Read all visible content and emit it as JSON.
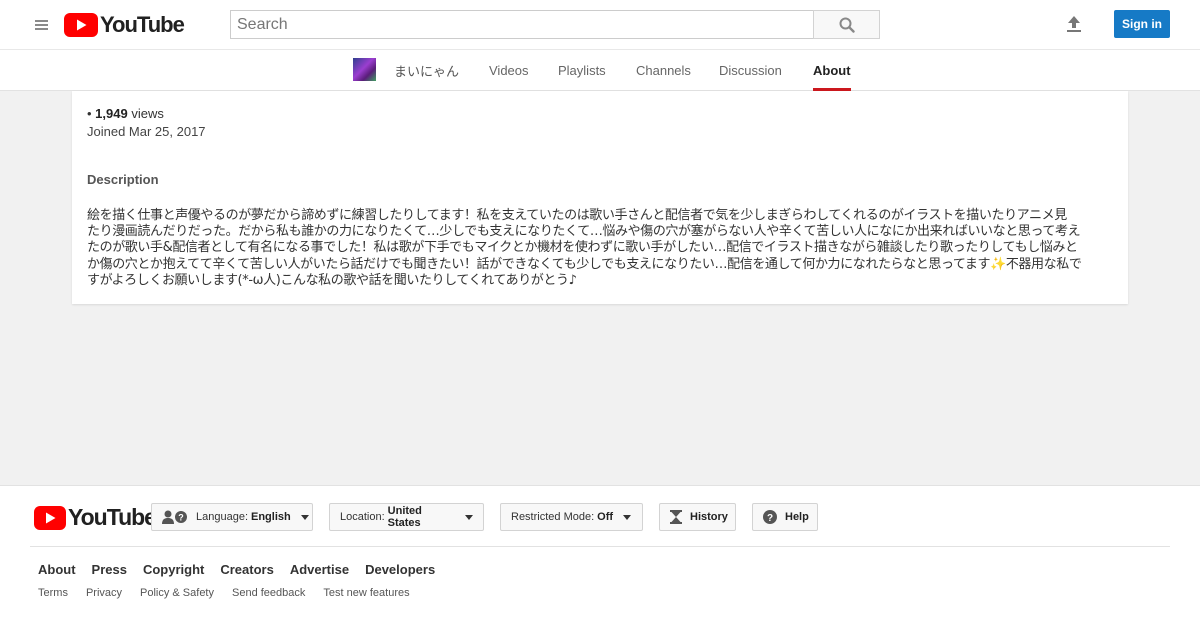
{
  "masthead": {
    "logo_text": "YouTube",
    "search_placeholder": "Search",
    "sign_in_label": "Sign in",
    "icons": [
      "menu-icon",
      "youtube-logo-icon",
      "search-icon",
      "upload-icon"
    ],
    "accent_color": "#167ac6",
    "brand_red": "#ff0000"
  },
  "channel": {
    "name": "まいにゃん",
    "tabs": [
      {
        "label": "Videos",
        "active": false
      },
      {
        "label": "Playlists",
        "active": false
      },
      {
        "label": "Channels",
        "active": false
      },
      {
        "label": "Discussion",
        "active": false
      },
      {
        "label": "About",
        "active": true
      }
    ],
    "active_tab_color": "#cc181e"
  },
  "about": {
    "views_prefix": "• ",
    "views_count": "1,949",
    "views_suffix": " views",
    "joined": "Joined Mar 25, 2017",
    "description_heading": "Description",
    "description_lines": [
      "絵を描く仕事と声優やるのが夢だから諦めずに練習したりしてます！私を支えていたのは歌い手さんと配信者で気を少しまぎらわしてくれるのがイラストを描いたりアニメ見",
      "たり漫画読んだりだった。だから私も誰かの力になりたくて…少しでも支えになりたくて…悩みや傷の穴が塞がらない人や辛くて苦しい人になにか出来ればいいなと思って考え",
      "たのが歌い手&配信者として有名になる事でした！私は歌が下手でもマイクとか機材を使わずに歌い手がしたい…配信でイラスト描きながら雑談したり歌ったりしてもし悩みと",
      "か傷の穴とか抱えてて辛くて苦しい人がいたら話だけでも聞きたい！話ができなくても少しでも支えになりたい…配信を通して何か力になれたらなと思ってます✨不器用な私で",
      "すがよろしくお願いします(*-ω人)こんな私の歌や話を聞いたりしてくれてありがとう♪"
    ]
  },
  "footer": {
    "logo_text": "YouTube",
    "language_label": "Language:",
    "language_value": "English",
    "location_label": "Location:",
    "location_value": "United States",
    "restricted_label": "Restricted Mode:",
    "restricted_value": "Off",
    "history_label": "History",
    "help_label": "Help",
    "primary_links": [
      "About",
      "Press",
      "Copyright",
      "Creators",
      "Advertise",
      "Developers"
    ],
    "secondary_links": [
      "Terms",
      "Privacy",
      "Policy & Safety",
      "Send feedback",
      "Test new features"
    ]
  }
}
